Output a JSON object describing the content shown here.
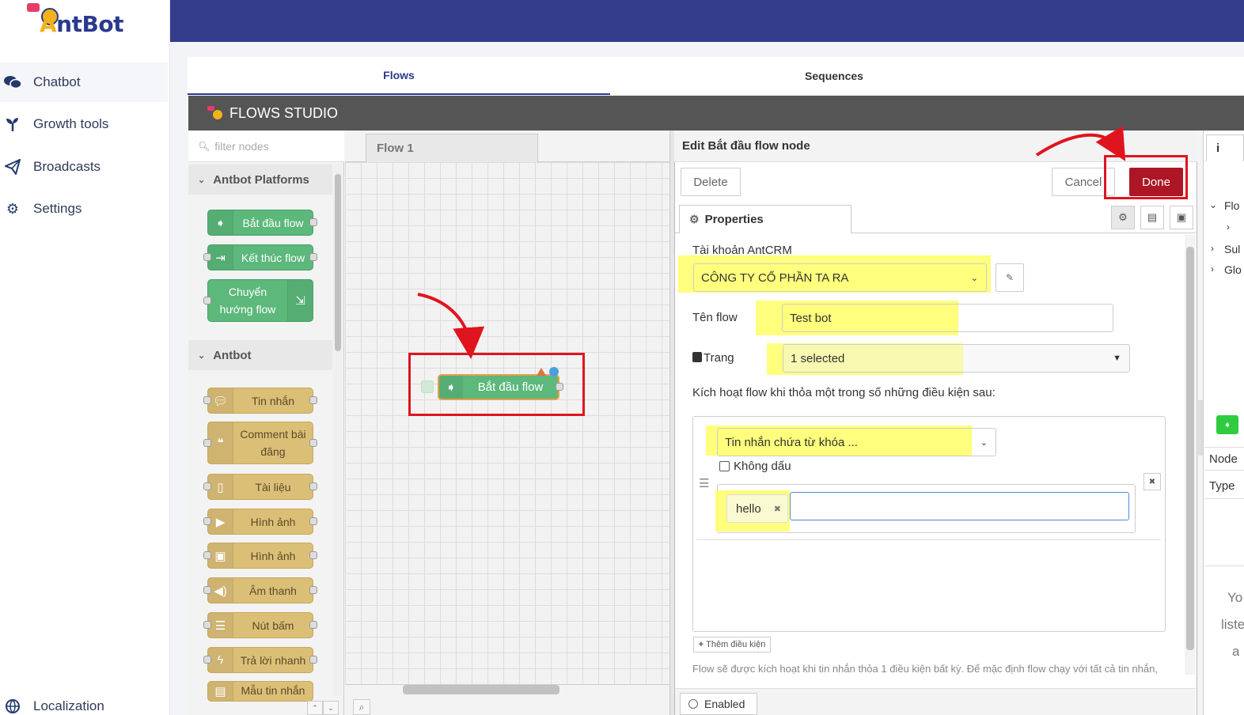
{
  "app": {
    "logo_text_a": "A",
    "logo_text_rest": "ntBot"
  },
  "sidebar": {
    "items": [
      {
        "label": "Chatbot",
        "icon": "chat-icon"
      },
      {
        "label": "Growth tools",
        "icon": "sprout-icon"
      },
      {
        "label": "Broadcasts",
        "icon": "paper-plane-icon"
      },
      {
        "label": "Settings",
        "icon": "gear-icon"
      }
    ],
    "footer_label": "Localization"
  },
  "tabs": [
    {
      "label": "Flows",
      "active": true
    },
    {
      "label": "Sequences",
      "active": false
    }
  ],
  "studio": {
    "title": "FLOWS STUDIO",
    "filter_placeholder": "filter nodes",
    "categories": [
      "Antbot Platforms",
      "Antbot"
    ],
    "platform_nodes": [
      "Bắt đầu flow",
      "Kết thúc flow",
      "Chuyển hướng flow"
    ],
    "antbot_nodes": [
      "Tin nhắn",
      "Comment bài đăng",
      "Tài liệu",
      "Hình ảnh",
      "Hình ảnh",
      "Âm thanh",
      "Nút bấm",
      "Trả lời nhanh",
      "Mẫu tin nhắn"
    ],
    "workspace_tab": "Flow 1",
    "workspace_node": "Bắt đầu flow"
  },
  "editor": {
    "title": "Edit Bắt đầu flow node",
    "delete_label": "Delete",
    "cancel_label": "Cancel",
    "done_label": "Done",
    "properties_tab": "Properties",
    "account_label": "Tài khoản AntCRM",
    "account_value": "CÔNG TY CỔ PHẦN TA RA",
    "flow_name_label": "Tên flow",
    "flow_name_value": "Test bot",
    "page_label": "Trang",
    "page_value": "1 selected",
    "trigger_label": "Kích hoạt flow khi thỏa một trong số những điều kiện sau:",
    "condition_type": "Tin nhắn chứa từ khóa ...",
    "no_accent_label": "Không dấu",
    "keyword_tag": "hello",
    "add_condition_label": "Thêm điều kiện",
    "help_text": "Flow sẽ được kích hoạt khi tin nhắn thỏa 1 điều kiện bất kỳ. Để mặc định flow chạy với tất cả tin nhắn,",
    "enabled_label": "Enabled"
  },
  "right_sidebar": {
    "tab_label": "i",
    "tree": [
      "Flo",
      "Sul",
      "Glo"
    ],
    "table_rows": [
      "Node",
      "Type"
    ],
    "footer_lines": [
      "Yo",
      "liste",
      "a"
    ]
  },
  "colors": {
    "topbar": "#343c8c",
    "done": "#ad1625",
    "highlight": "#ffff66",
    "annotation_red": "#e0141e",
    "node_green": "#5cb87b",
    "node_gold": "#dcbf77"
  }
}
